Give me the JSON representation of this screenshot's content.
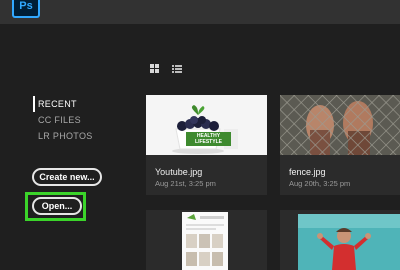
{
  "app": {
    "logo_text": "Ps"
  },
  "view_toggle": {
    "grid_icon": "grid-view-icon",
    "list_icon": "list-view-icon"
  },
  "nav": {
    "items": [
      {
        "label": "RECENT",
        "active": true
      },
      {
        "label": "CC FILES",
        "active": false
      },
      {
        "label": "LR PHOTOS",
        "active": false
      }
    ]
  },
  "buttons": {
    "create_label": "Create new...",
    "open_label": "Open..."
  },
  "highlight_color": "#3bd42a",
  "files": [
    {
      "name": "Youtube.jpg",
      "date": "Aug 21st, 3:25 pm",
      "thumb_text": "HEALTHY LIFESTYLE"
    },
    {
      "name": "fence.jpg",
      "date": "Aug 20th, 3:25 pm"
    }
  ]
}
